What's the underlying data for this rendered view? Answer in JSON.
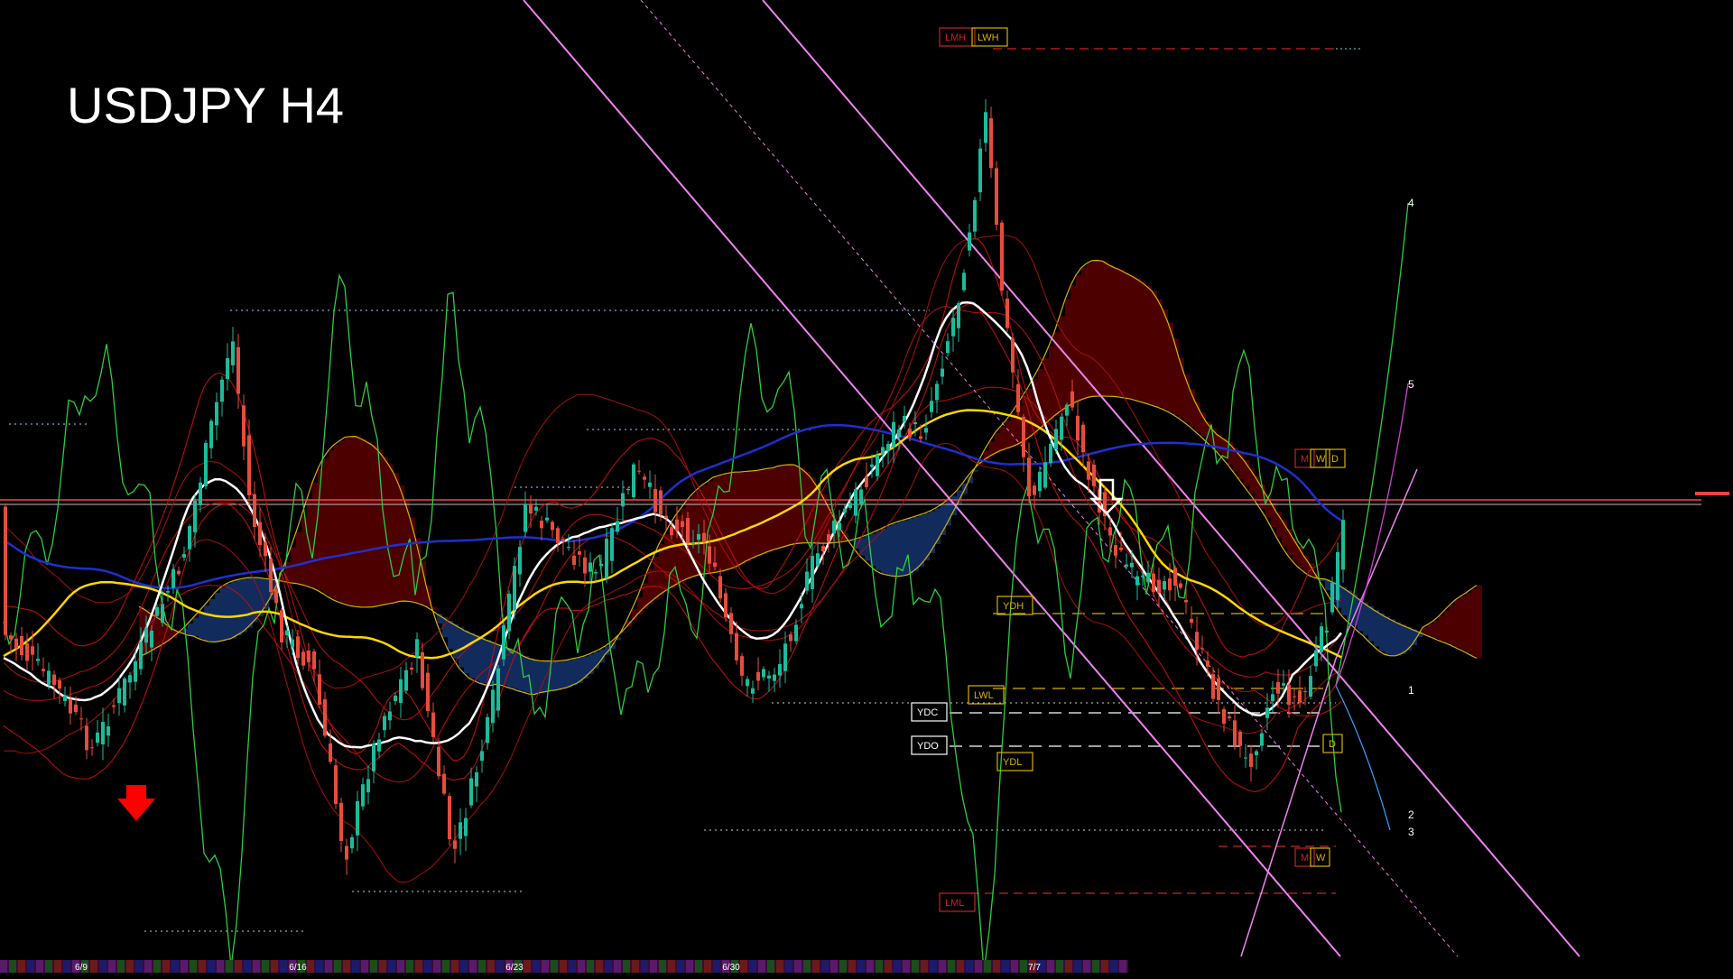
{
  "title": "USDJPY H4",
  "chart_data": {
    "type": "candlestick",
    "title": "USDJPY H4",
    "timeframe": "H4",
    "symbol": "USDJPY",
    "date_ticks": [
      "6/9",
      "6/16",
      "6/23",
      "6/30",
      "7/7"
    ],
    "level_tags": {
      "top": [
        "LMH",
        "LWH"
      ],
      "mid_right": [
        "M",
        "W",
        "D"
      ],
      "ydh": "YDH",
      "ydc": "YDC",
      "ydo": "YDO",
      "ydl": "YDL",
      "lwl": "LWL",
      "d_low": "D",
      "mw_low": [
        "M",
        "W"
      ],
      "lml": "LML"
    },
    "projection_labels": [
      "4",
      "5",
      "1",
      "2",
      "3"
    ],
    "signals": [
      {
        "kind": "buy-arrow",
        "color": "#ff0000"
      },
      {
        "kind": "sell-arrow",
        "color": "#ffffff"
      }
    ],
    "colors": {
      "bull": "#1abc9c",
      "bear": "#e74c3c",
      "ma_white": "#ffffff",
      "ma_yellow": "#ffd700",
      "ma_blue": "#1f2fd0",
      "oscillator": "#2ecc40",
      "bands": "#cc1111",
      "cloud_bear": "#8b0000",
      "cloud_bull": "#1e4fa8",
      "trend_channel": "#ee82ee",
      "price_line": "#ff4040"
    }
  }
}
